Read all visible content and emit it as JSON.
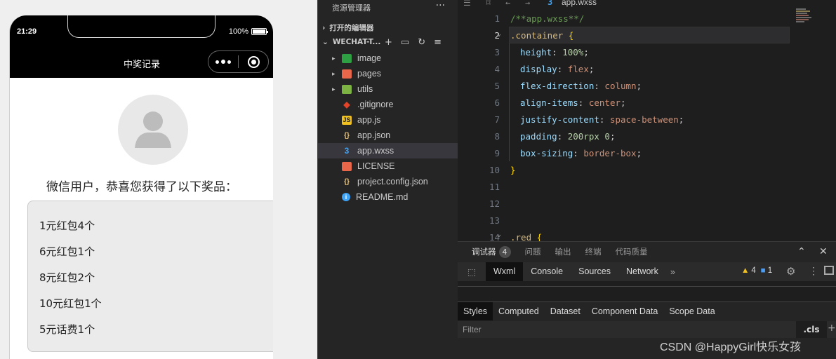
{
  "phone": {
    "time": "21:29",
    "battery": "100%",
    "title": "中奖记录",
    "greeting": "微信用户，恭喜您获得了以下奖品：",
    "prizes": [
      "1元红包4个",
      "6元红包1个",
      "8元红包2个",
      "10元红包1个",
      "5元话费1个"
    ]
  },
  "explorer": {
    "header": "资源管理器",
    "header_menu": "···",
    "open_editors": "打开的编辑器",
    "project": "WECHAT-T...",
    "items": [
      {
        "name": "image",
        "icon": "folder-image-icon",
        "color": "#2ea043",
        "folder": true
      },
      {
        "name": "pages",
        "icon": "folder-pages-icon",
        "color": "#e8664a",
        "folder": true
      },
      {
        "name": "utils",
        "icon": "folder-utils-icon",
        "color": "#7cb342",
        "folder": true
      },
      {
        "name": ".gitignore",
        "icon": "git-icon",
        "color": "#e24329",
        "folder": false
      },
      {
        "name": "app.js",
        "icon": "js-file-icon",
        "color": "#f0c020",
        "folder": false
      },
      {
        "name": "app.json",
        "icon": "json-file-icon",
        "color": "#e5c07b",
        "folder": false
      },
      {
        "name": "app.wxss",
        "icon": "css-file-icon",
        "color": "#3ea3f5",
        "folder": false
      },
      {
        "name": "LICENSE",
        "icon": "license-icon",
        "color": "#e8664a",
        "folder": false
      },
      {
        "name": "project.config.json",
        "icon": "json-file-icon",
        "color": "#e5c07b",
        "folder": false
      },
      {
        "name": "README.md",
        "icon": "info-icon",
        "color": "#3ea3f5",
        "folder": false
      }
    ]
  },
  "editor": {
    "tab_name": "app.wxss",
    "line_numbers": [
      "1",
      "2",
      "3",
      "4",
      "5",
      "6",
      "7",
      "8",
      "9",
      "10",
      "11",
      "12",
      "13",
      "14"
    ],
    "current_line": "2",
    "comment": "/**app.wxss**/",
    "selector1": ".container",
    "open_brace": "{",
    "close_brace": "}",
    "selector2": ".red",
    "props": [
      {
        "name": "height",
        "value": "100%",
        "kind": "num"
      },
      {
        "name": "display",
        "value": "flex",
        "kind": "kw"
      },
      {
        "name": "flex-direction",
        "value": "column",
        "kind": "kw"
      },
      {
        "name": "align-items",
        "value": "center",
        "kind": "kw"
      },
      {
        "name": "justify-content",
        "value": "space-between",
        "kind": "kw"
      },
      {
        "name": "padding",
        "value": "200rpx 0",
        "kind": "num"
      },
      {
        "name": "box-sizing",
        "value": "border-box",
        "kind": "kw"
      }
    ]
  },
  "devtools": {
    "tabs": [
      "调试器",
      "问题",
      "输出",
      "终端",
      "代码质量"
    ],
    "debugger_count": "4",
    "toolbar": [
      "Wxml",
      "Console",
      "Sources",
      "Network"
    ],
    "more": "»",
    "warnings": "4",
    "messages": "1",
    "subtabs": [
      "Styles",
      "Computed",
      "Dataset",
      "Component Data",
      "Scope Data"
    ],
    "filter_placeholder": "Filter",
    "cls": ".cls",
    "plus": "+"
  },
  "watermark": "CSDN @HappyGirl快乐女孩"
}
